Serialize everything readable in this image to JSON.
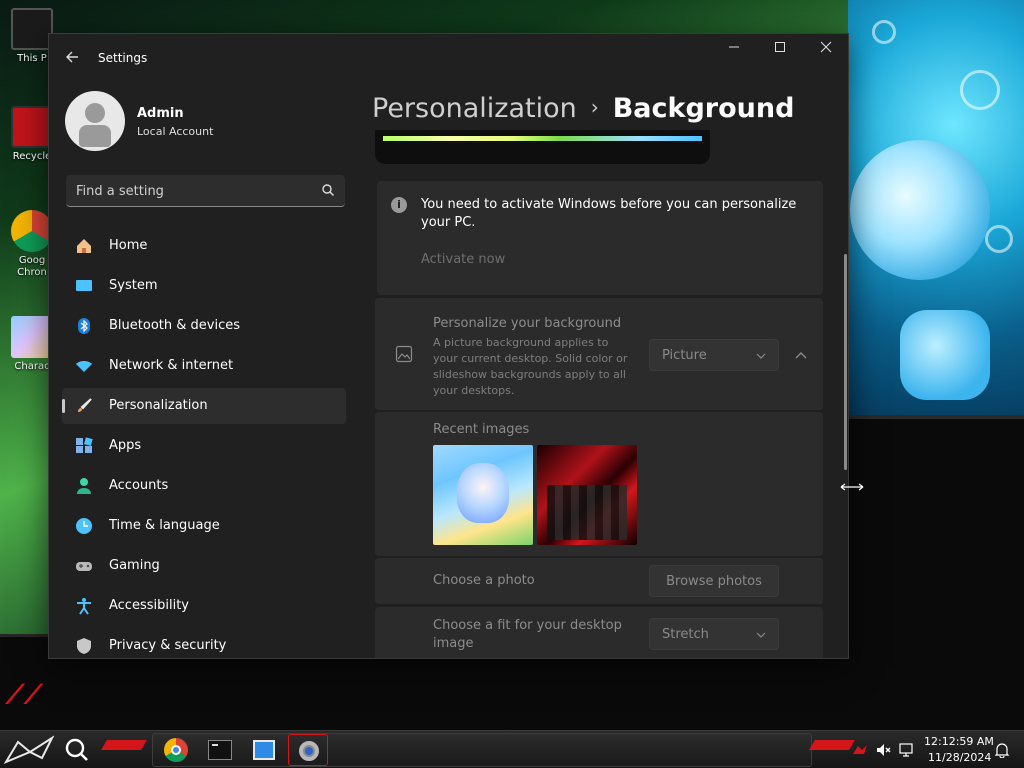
{
  "desktop": {
    "icons": [
      {
        "label": "This P"
      },
      {
        "label": "Recycle"
      },
      {
        "label": "Goog Chron"
      },
      {
        "label": "Charac"
      }
    ]
  },
  "window": {
    "title": "Settings",
    "controls": {
      "minimize": "minimize-icon",
      "maximize": "maximize-icon",
      "close": "close-icon"
    }
  },
  "profile": {
    "name": "Admin",
    "account_type": "Local Account"
  },
  "search": {
    "placeholder": "Find a setting"
  },
  "nav": {
    "items": [
      {
        "label": "Home",
        "icon": "home-icon"
      },
      {
        "label": "System",
        "icon": "system-icon"
      },
      {
        "label": "Bluetooth & devices",
        "icon": "bluetooth-icon"
      },
      {
        "label": "Network & internet",
        "icon": "network-icon"
      },
      {
        "label": "Personalization",
        "icon": "brush-icon",
        "active": true
      },
      {
        "label": "Apps",
        "icon": "apps-icon"
      },
      {
        "label": "Accounts",
        "icon": "accounts-icon"
      },
      {
        "label": "Time & language",
        "icon": "time-language-icon"
      },
      {
        "label": "Gaming",
        "icon": "gaming-icon"
      },
      {
        "label": "Accessibility",
        "icon": "accessibility-icon"
      },
      {
        "label": "Privacy & security",
        "icon": "privacy-icon"
      }
    ]
  },
  "breadcrumb": {
    "parent": "Personalization",
    "separator": "›",
    "current": "Background"
  },
  "activation_notice": {
    "text": "You need to activate Windows before you can personalize your PC.",
    "link": "Activate now"
  },
  "personalize_background": {
    "title": "Personalize your background",
    "description": "A picture background applies to your current desktop. Solid color or slideshow backgrounds apply to all your desktops.",
    "selected": "Picture"
  },
  "recent_images": {
    "title": "Recent images"
  },
  "choose_photo": {
    "title": "Choose a photo",
    "button": "Browse photos"
  },
  "choose_fit": {
    "title": "Choose a fit for your desktop image",
    "selected": "Stretch"
  },
  "taskbar": {
    "apps": [
      "chrome-icon",
      "terminal-icon",
      "explorer-icon",
      "settings-icon"
    ],
    "clock": {
      "time": "12:12:59 AM",
      "date": "11/28/2024"
    }
  },
  "colors": {
    "accent_red": "#d4161b",
    "window_bg": "#202020",
    "card_bg": "#2b2b2b"
  }
}
